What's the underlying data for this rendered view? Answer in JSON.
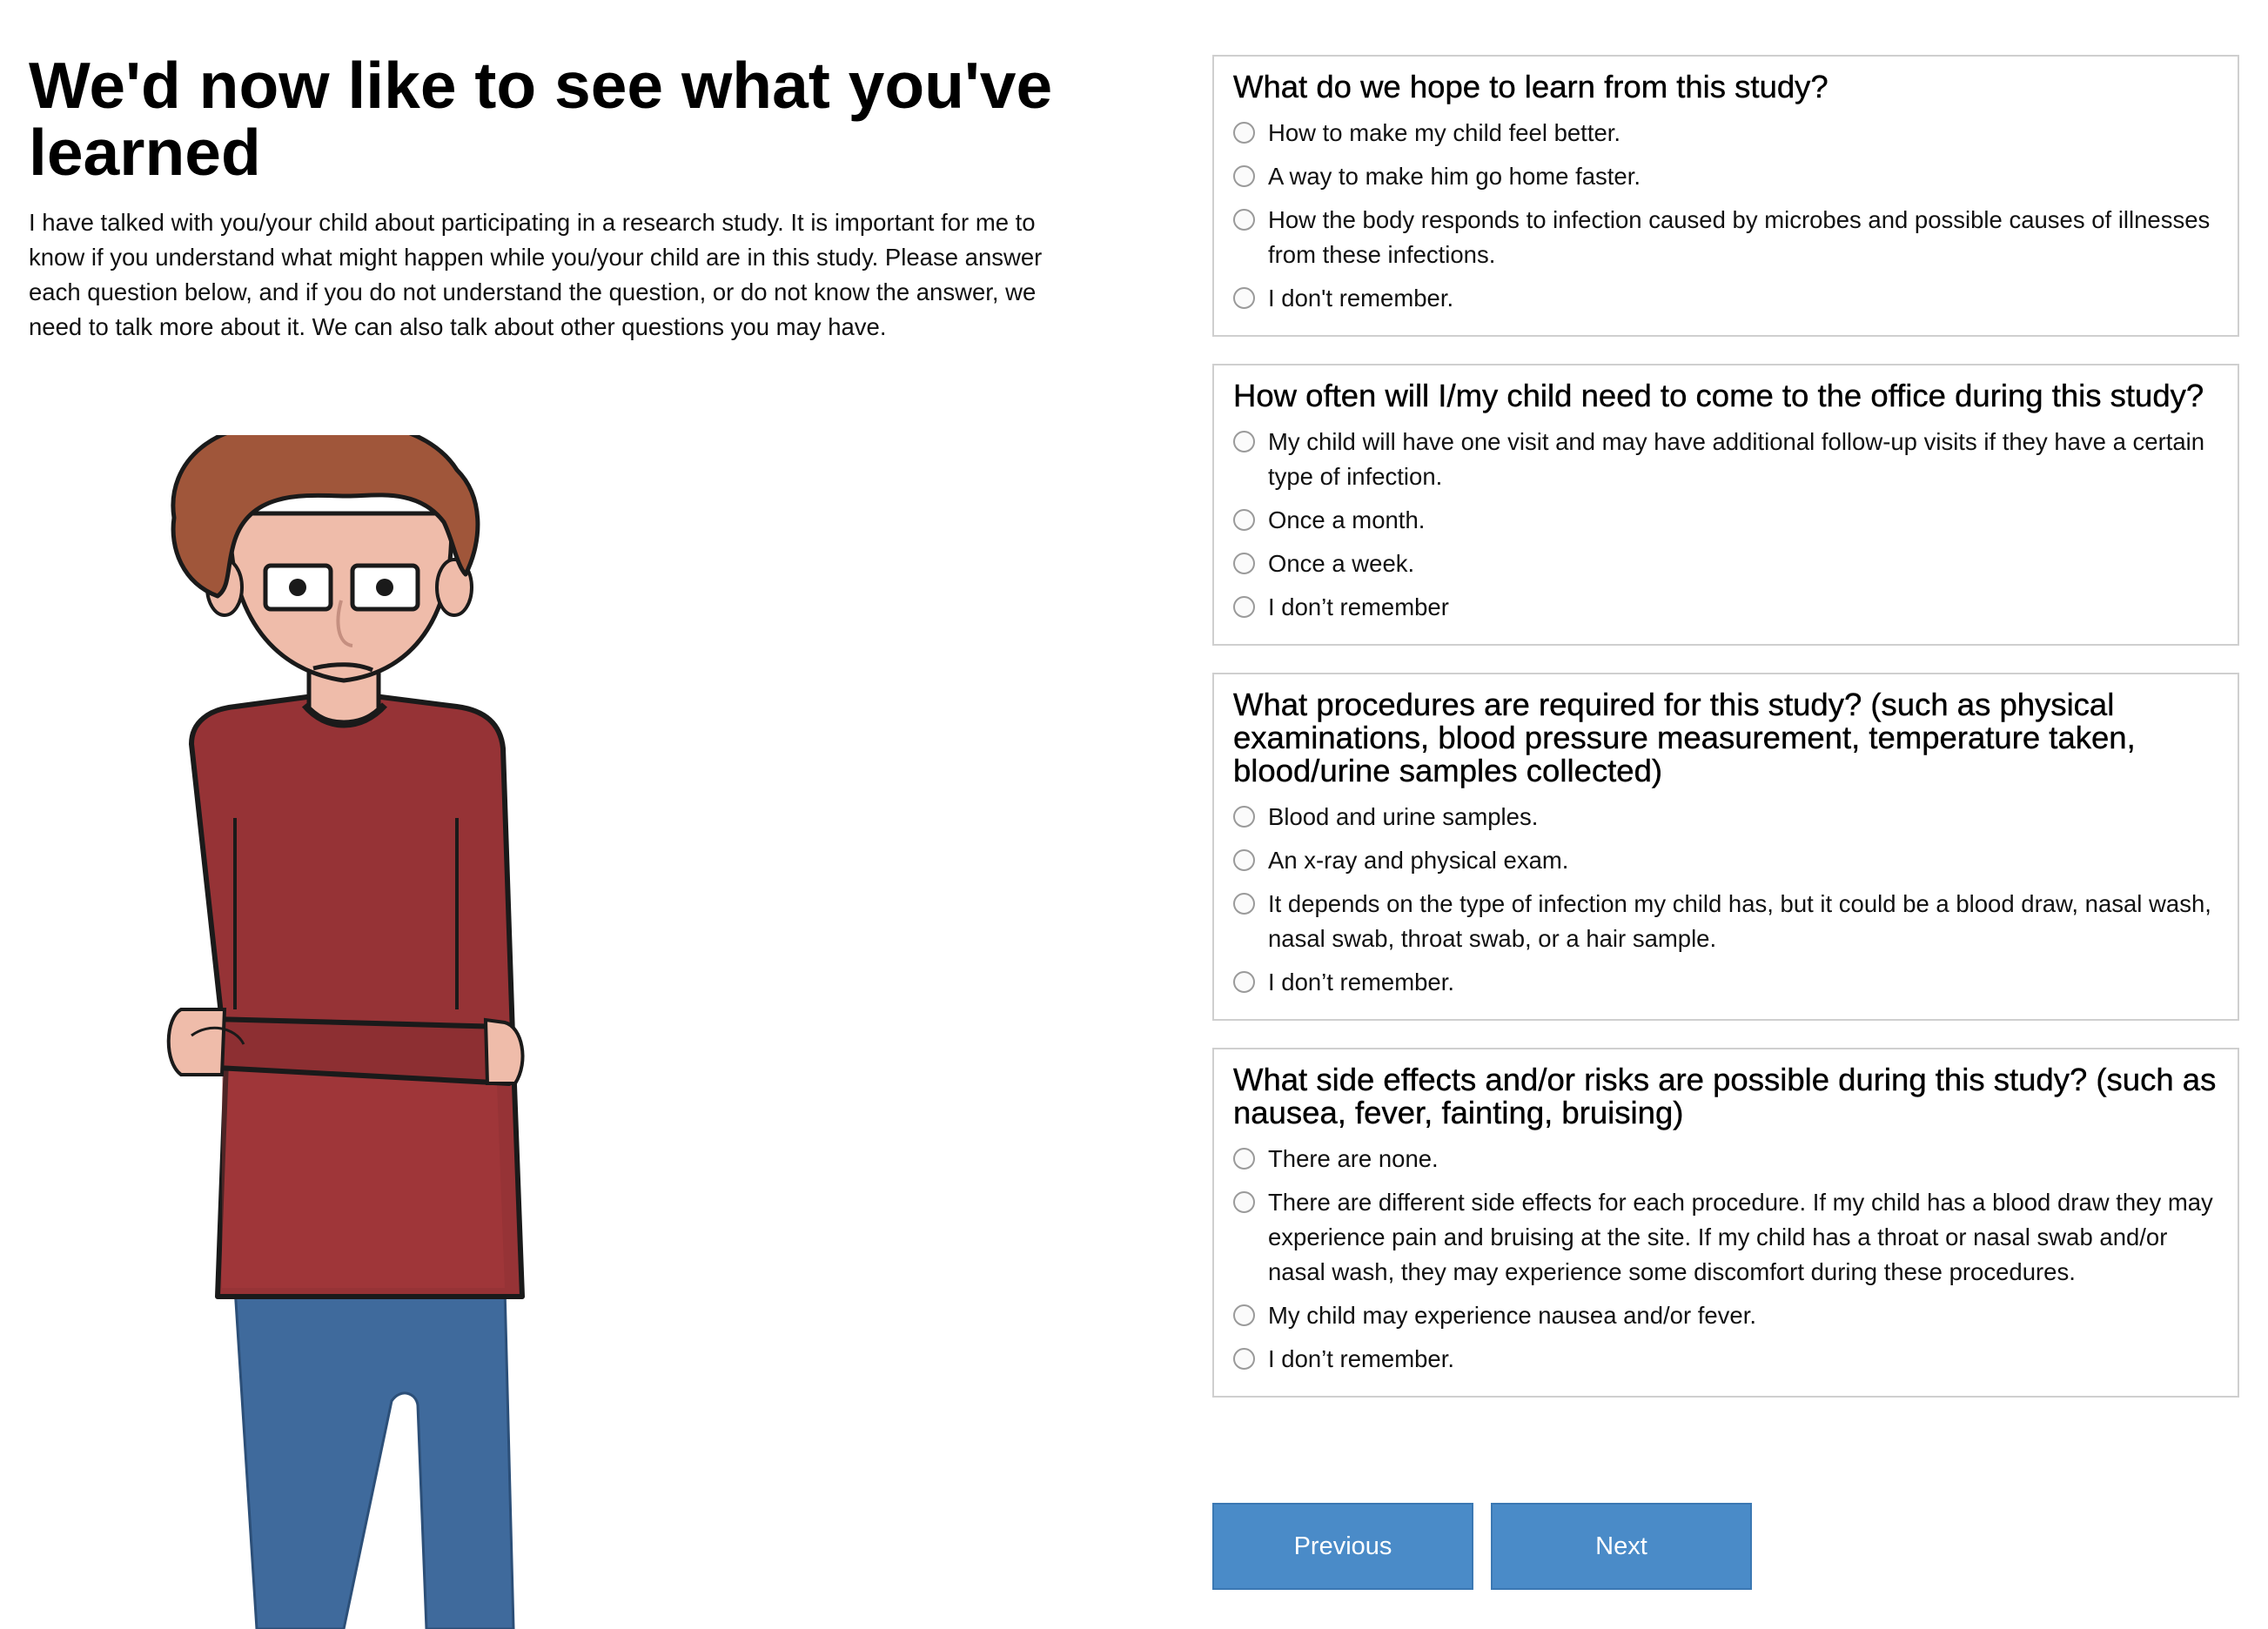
{
  "header": {
    "title": "We'd now like to see what you've learned",
    "intro": "I have talked with you/your child about participating in a research study. It is important for me to know if you understand what might happen while you/your child are in this study. Please answer each question below, and if you do not understand the question, or do not know the answer, we need to talk more about it. We can also talk about other questions you may have."
  },
  "questions": [
    {
      "title": "What do we hope to learn from this study?",
      "options": [
        "How to make my child feel better.",
        "A way to make him go home faster.",
        "How the body responds to infection caused by microbes and possible causes of illnesses from these infections.",
        "I don't remember."
      ]
    },
    {
      "title": "How often will I/my child need to come to the office during this study?",
      "options": [
        "My child will have one visit and may have additional follow-up visits if they have a certain type of infection.",
        "Once a month.",
        "Once a week.",
        "I don’t remember"
      ]
    },
    {
      "title": "What procedures are required for this study? (such as physical examinations, blood pressure measurement, temperature taken, blood/urine samples collected)",
      "options": [
        "Blood and urine samples.",
        "An x-ray and physical exam.",
        "It depends on the type of infection my child has, but it could be a blood draw, nasal wash, nasal swab, throat swab, or a hair sample.",
        "I don’t remember."
      ]
    },
    {
      "title": "What side effects and/or risks are possible during this study? (such as nausea, fever, fainting, bruising)",
      "options": [
        "There are none.",
        "There are different side effects for each procedure. If my child has a blood draw they may experience pain and bruising at the site. If my child has a throat or nasal swab and/or nasal wash, they may experience some discomfort during these procedures.",
        "My child may experience nausea and/or fever.",
        "I don’t remember."
      ]
    }
  ],
  "nav": {
    "previous_label": "Previous",
    "next_label": "Next"
  },
  "colors": {
    "button": "#4a8bc8",
    "shirt": "#963336",
    "pants": "#3f6a9c",
    "hair": "#a0563a",
    "skin": "#efbcaa"
  }
}
